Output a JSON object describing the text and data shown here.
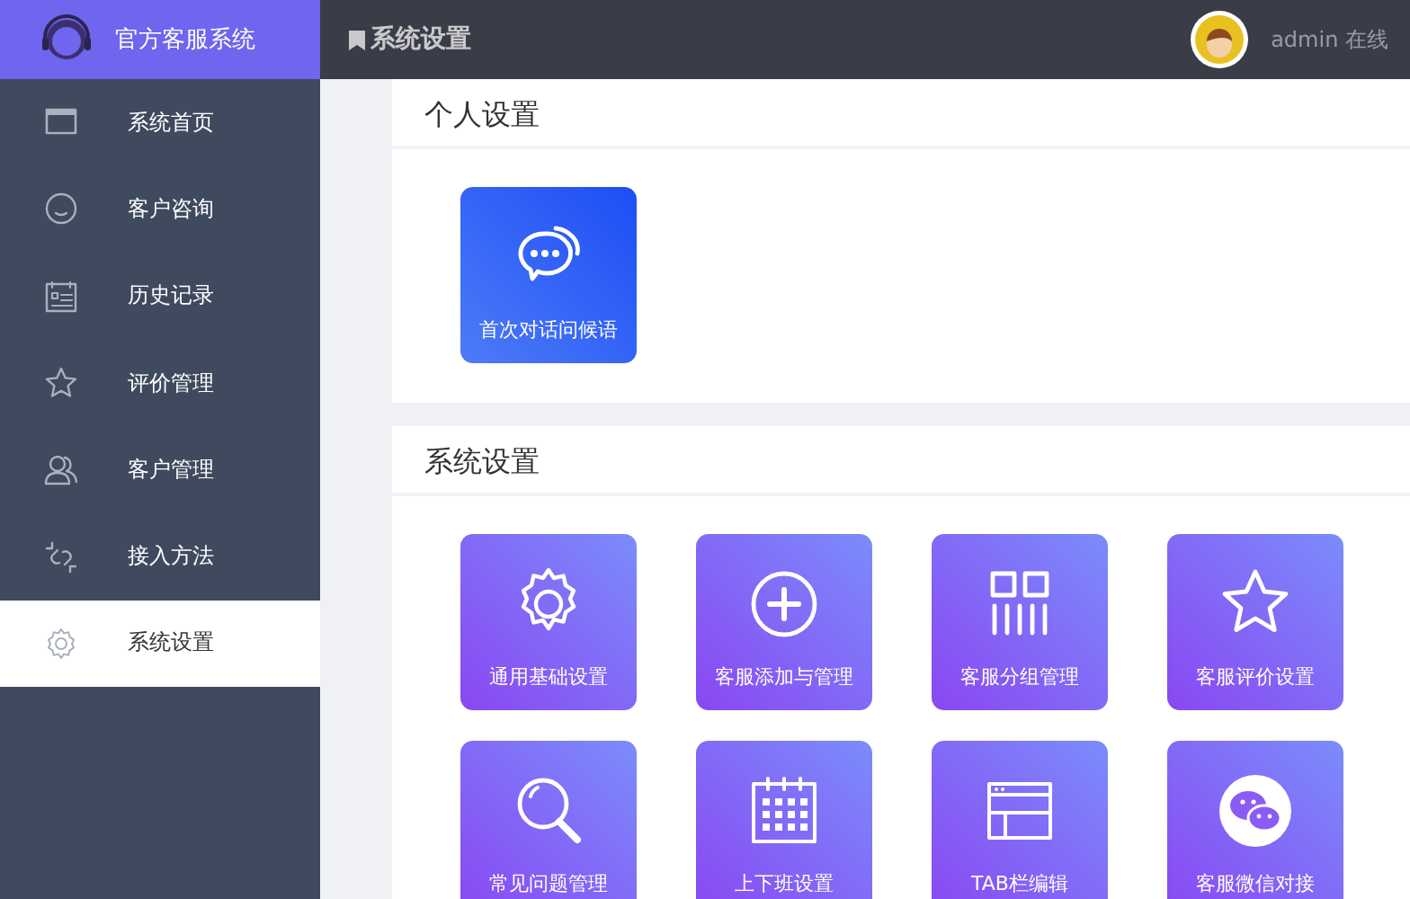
{
  "brand": {
    "title": "官方客服系统"
  },
  "header": {
    "title": "系统设置",
    "user": "admin 在线"
  },
  "sidebar": {
    "items": [
      {
        "label": "系统首页",
        "selected": false
      },
      {
        "label": "客户咨询",
        "selected": false
      },
      {
        "label": "历史记录",
        "selected": false
      },
      {
        "label": "评价管理",
        "selected": false
      },
      {
        "label": "客户管理",
        "selected": false
      },
      {
        "label": "接入方法",
        "selected": false
      },
      {
        "label": "系统设置",
        "selected": true
      }
    ]
  },
  "sections": [
    {
      "title": "个人设置",
      "tiles": [
        {
          "label": "首次对话问候语"
        }
      ]
    },
    {
      "title": "系统设置",
      "tiles": [
        {
          "label": "通用基础设置"
        },
        {
          "label": "客服添加与管理"
        },
        {
          "label": "客服分组管理"
        },
        {
          "label": "客服评价设置"
        },
        {
          "label": "常见问题管理"
        },
        {
          "label": "上下班设置"
        },
        {
          "label": "TAB栏编辑"
        },
        {
          "label": "客服微信对接"
        }
      ]
    }
  ]
}
